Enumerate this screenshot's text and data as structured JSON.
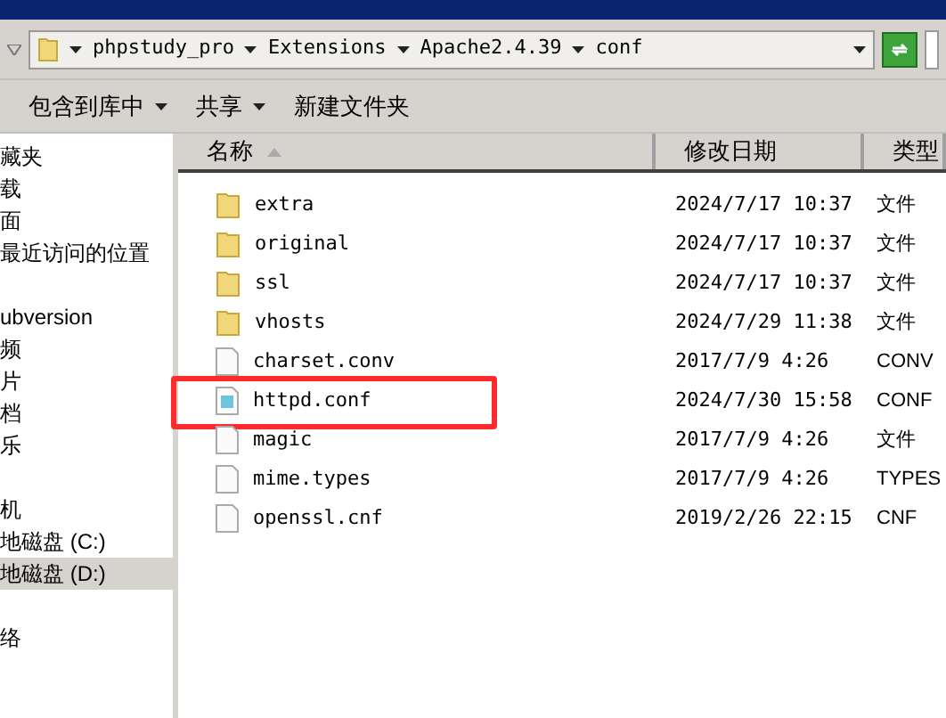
{
  "address_bar": {
    "crumbs": [
      "phpstudy_pro",
      "Extensions",
      "Apache2.4.39",
      "conf"
    ]
  },
  "toolbar": {
    "buttons": [
      {
        "label": "包含到库中",
        "dropdown": true
      },
      {
        "label": "共享",
        "dropdown": true
      },
      {
        "label": "新建文件夹",
        "dropdown": false
      }
    ]
  },
  "sidebar": {
    "groups": [
      {
        "items": [
          {
            "label": "藏夹",
            "selected": false
          },
          {
            "label": "载",
            "selected": false
          },
          {
            "label": "面",
            "selected": false
          },
          {
            "label": "最近访问的位置",
            "selected": false
          }
        ]
      },
      {
        "items": [
          {
            "label": "ubversion",
            "selected": false
          },
          {
            "label": "频",
            "selected": false
          },
          {
            "label": "片",
            "selected": false
          },
          {
            "label": "档",
            "selected": false
          },
          {
            "label": "乐",
            "selected": false
          }
        ]
      },
      {
        "items": [
          {
            "label": "机",
            "selected": false
          },
          {
            "label": "地磁盘 (C:)",
            "selected": false
          },
          {
            "label": "地磁盘 (D:)",
            "selected": true
          }
        ]
      },
      {
        "items": [
          {
            "label": "络",
            "selected": false
          }
        ]
      }
    ]
  },
  "table": {
    "columns": [
      "名称",
      "修改日期",
      "类型"
    ],
    "rows": [
      {
        "kind": "folder",
        "name": "extra",
        "date": "2024/7/17 10:37",
        "type": "文件",
        "highlighted": false
      },
      {
        "kind": "folder",
        "name": "original",
        "date": "2024/7/17 10:37",
        "type": "文件",
        "highlighted": false
      },
      {
        "kind": "folder",
        "name": "ssl",
        "date": "2024/7/17 10:37",
        "type": "文件",
        "highlighted": false
      },
      {
        "kind": "folder",
        "name": "vhosts",
        "date": "2024/7/29 11:38",
        "type": "文件",
        "highlighted": false
      },
      {
        "kind": "file",
        "name": "charset.conv",
        "date": "2017/7/9 4:26",
        "type": "CONV",
        "highlighted": false
      },
      {
        "kind": "config",
        "name": "httpd.conf",
        "date": "2024/7/30 15:58",
        "type": "CONF",
        "highlighted": true
      },
      {
        "kind": "file",
        "name": "magic",
        "date": "2017/7/9 4:26",
        "type": "文件",
        "highlighted": false
      },
      {
        "kind": "file",
        "name": "mime.types",
        "date": "2017/7/9 4:26",
        "type": "TYPES",
        "highlighted": false
      },
      {
        "kind": "file",
        "name": "openssl.cnf",
        "date": "2019/2/26 22:15",
        "type": "CNF",
        "highlighted": false
      }
    ]
  }
}
